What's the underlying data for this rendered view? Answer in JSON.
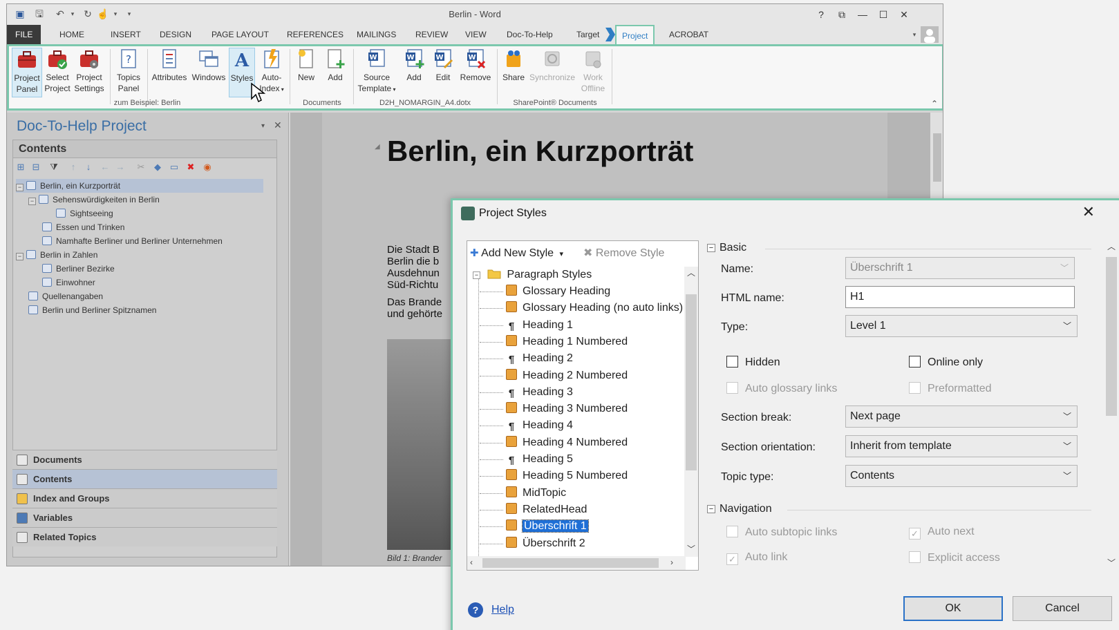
{
  "word": {
    "title": "Berlin  - Word",
    "help": "?",
    "tabs": {
      "file": "FILE",
      "home": "HOME",
      "insert": "INSERT",
      "design": "DESIGN",
      "page_layout": "PAGE LAYOUT",
      "references": "REFERENCES",
      "mailings": "MAILINGS",
      "review": "REVIEW",
      "view": "VIEW",
      "doc_to_help": "Doc-To-Help",
      "target": "Target",
      "project": "Project",
      "acrobat": "ACROBAT"
    },
    "ribbon": {
      "project_panel": [
        "Project",
        "Panel"
      ],
      "select_project": [
        "Select",
        "Project"
      ],
      "project_settings": [
        "Project",
        "Settings"
      ],
      "topics_panel": [
        "Topics",
        "Panel"
      ],
      "attributes": "Attributes",
      "windows": "Windows",
      "styles": "Styles",
      "auto_index": [
        "Auto-",
        "Index"
      ],
      "new": "New",
      "add_doc": "Add",
      "source_template": [
        "Source",
        "Template"
      ],
      "add_tpl": "Add",
      "edit": "Edit",
      "remove": "Remove",
      "share": "Share",
      "synchronize": "Synchronize",
      "work_offline": [
        "Work",
        "Offline"
      ],
      "group_project": "zum Beispiel: Berlin",
      "group_documents": "Documents",
      "group_template": "D2H_NOMARGIN_A4.dotx",
      "group_sharepoint": "SharePoint® Documents"
    },
    "panel": {
      "title": "Doc-To-Help Project",
      "contents_header": "Contents",
      "tree": [
        "Berlin, ein Kurzporträt",
        "Sehenswürdigkeiten in Berlin",
        "Sightseeing",
        "Essen und Trinken",
        "Namhafte Berliner und Berliner Unternehmen",
        "Berlin in Zahlen",
        "Berliner Bezirke",
        "Einwohner",
        "Quellenangaben",
        "Berlin und Berliner Spitznamen"
      ],
      "nav": [
        "Documents",
        "Contents",
        "Index and Groups",
        "Variables",
        "Related Topics"
      ]
    },
    "document": {
      "heading": "Berlin, ein Kurzporträt",
      "para1": [
        "Die Stadt B",
        "Berlin die b",
        "Ausdehnun",
        "Süd-Richtu"
      ],
      "para2": [
        "Das Brande",
        "und gehörte"
      ],
      "caption": "Bild 1: Brander"
    }
  },
  "dialog": {
    "title": "Project Styles",
    "toolbar": {
      "add_new_style": "Add New Style",
      "remove_style": "Remove Style"
    },
    "tree": {
      "root": "Paragraph Styles",
      "items": [
        "Glossary Heading",
        "Glossary Heading (no auto links)",
        "Heading 1",
        "Heading 1 Numbered",
        "Heading 2",
        "Heading 2 Numbered",
        "Heading 3",
        "Heading 3 Numbered",
        "Heading 4",
        "Heading 4 Numbered",
        "Heading 5",
        "Heading 5 Numbered",
        "MidTopic",
        "RelatedHead",
        "Überschrift 1",
        "Überschrift 2"
      ],
      "selected": "Überschrift 1"
    },
    "basic": {
      "section": "Basic",
      "name_label": "Name:",
      "name_value": "Überschrift 1",
      "html_name_label": "HTML name:",
      "html_name_value": "H1",
      "type_label": "Type:",
      "type_value": "Level 1",
      "hidden": "Hidden",
      "online_only": "Online only",
      "auto_glossary_links": "Auto glossary links",
      "preformatted": "Preformatted",
      "section_break_label": "Section break:",
      "section_break_value": "Next page",
      "section_orientation_label": "Section orientation:",
      "section_orientation_value": "Inherit from template",
      "topic_type_label": "Topic type:",
      "topic_type_value": "Contents"
    },
    "navigation": {
      "section": "Navigation",
      "auto_subtopic_links": "Auto subtopic links",
      "auto_next": "Auto next",
      "auto_link": "Auto link",
      "explicit_access": "Explicit access"
    },
    "buttons": {
      "help": "Help",
      "ok": "OK",
      "cancel": "Cancel"
    }
  }
}
